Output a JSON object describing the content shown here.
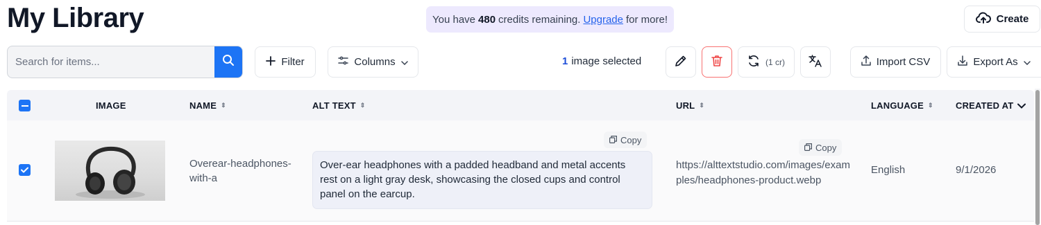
{
  "page": {
    "title": "My Library"
  },
  "credits": {
    "prefix": "You have",
    "count": "480",
    "middle": "credits remaining.",
    "link": "Upgrade",
    "suffix": "for more!"
  },
  "header": {
    "create_label": "Create",
    "create_icon": "cloud-upload-icon"
  },
  "toolbar": {
    "search_placeholder": "Search for items...",
    "filter_label": "Filter",
    "columns_label": "Columns",
    "selected_count": "1",
    "selected_text": "image selected",
    "regenerate_cost": "(1 cr)",
    "import_label": "Import CSV",
    "export_label": "Export As",
    "delete_color": "#ef4444",
    "accent_color": "#1d74f5"
  },
  "table": {
    "headers": {
      "image": "IMAGE",
      "name": "NAME",
      "alt_text": "ALT TEXT",
      "url": "URL",
      "language": "LANGUAGE",
      "created_at": "CREATED AT"
    },
    "rows": [
      {
        "selected": true,
        "name": "Overear-headphones-with-a",
        "alt_text": "Over-ear headphones with a padded headband and metal accents rest on a light gray desk, showcasing the closed cups and control panel on the earcup.",
        "url": "https://alttextstudio.com/images/examples/headphones-product.webp",
        "language": "English",
        "created_at": "9/1/2026",
        "copy_label": "Copy"
      }
    ]
  }
}
